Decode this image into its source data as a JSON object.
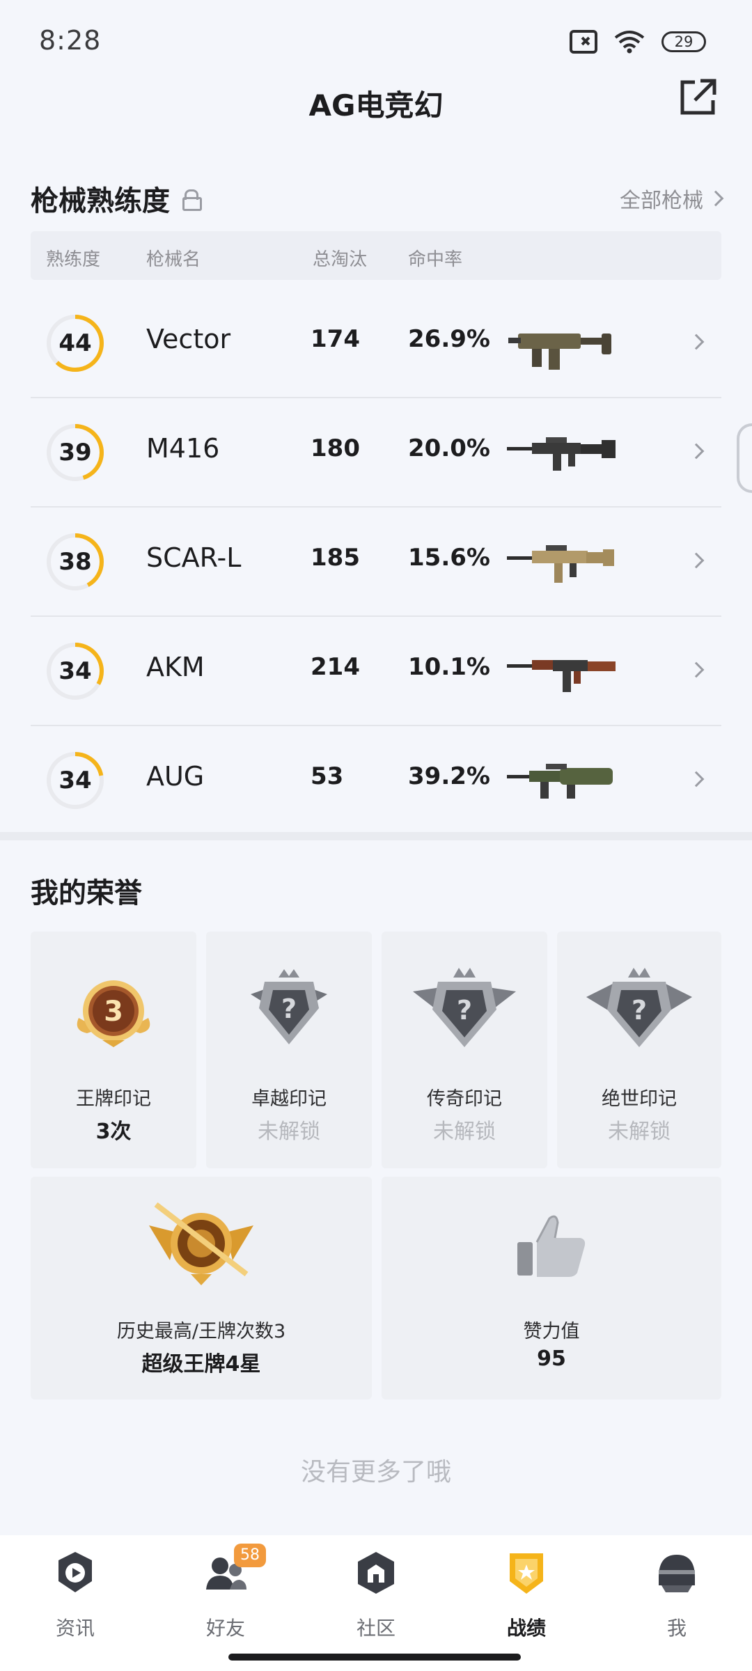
{
  "status": {
    "time": "8:28",
    "battery": "29"
  },
  "header": {
    "title": "AG电竞幻"
  },
  "weapons_section": {
    "title": "枪械熟练度",
    "all_link": "全部枪械",
    "columns": {
      "mastery": "熟练度",
      "name": "枪械名",
      "kills": "总淘汰",
      "accuracy": "命中率"
    },
    "rows": [
      {
        "mastery": "44",
        "name": "Vector",
        "kills": "174",
        "accuracy": "26.9%",
        "progress": 0.62,
        "icon": "smg-vector-icon"
      },
      {
        "mastery": "39",
        "name": "M416",
        "kills": "180",
        "accuracy": "20.0%",
        "progress": 0.45,
        "icon": "rifle-m416-icon"
      },
      {
        "mastery": "38",
        "name": "SCAR-L",
        "kills": "185",
        "accuracy": "15.6%",
        "progress": 0.42,
        "icon": "rifle-scarl-icon"
      },
      {
        "mastery": "34",
        "name": "AKM",
        "kills": "214",
        "accuracy": "10.1%",
        "progress": 0.33,
        "icon": "rifle-akm-icon"
      },
      {
        "mastery": "34",
        "name": "AUG",
        "kills": "53",
        "accuracy": "39.2%",
        "progress": 0.22,
        "icon": "rifle-aug-icon"
      }
    ]
  },
  "honors": {
    "title": "我的荣誉",
    "cards": [
      {
        "label": "王牌印记",
        "value": "3次",
        "locked": false,
        "icon": "ace-mark-badge-icon",
        "badge_number": "3"
      },
      {
        "label": "卓越印记",
        "value": "未解锁",
        "locked": true,
        "icon": "excellence-mark-badge-icon"
      },
      {
        "label": "传奇印记",
        "value": "未解锁",
        "locked": true,
        "icon": "legend-mark-badge-icon"
      },
      {
        "label": "绝世印记",
        "value": "未解锁",
        "locked": true,
        "icon": "peerless-mark-badge-icon"
      }
    ],
    "wide_cards": [
      {
        "label": "历史最高/王牌次数3",
        "value": "超级王牌4星",
        "icon": "rank-ace-emblem-icon"
      },
      {
        "label": "赞力值",
        "value": "95",
        "icon": "thumbs-up-icon"
      }
    ]
  },
  "footer_note": "没有更多了哦",
  "bottom_nav": [
    {
      "label": "资讯",
      "icon": "news-icon",
      "active": false
    },
    {
      "label": "好友",
      "icon": "friends-icon",
      "active": false,
      "badge": "58"
    },
    {
      "label": "社区",
      "icon": "community-icon",
      "active": false
    },
    {
      "label": "战绩",
      "icon": "record-icon",
      "active": true
    },
    {
      "label": "我",
      "icon": "profile-helmet-icon",
      "active": false
    }
  ],
  "colors": {
    "accent": "#f5b41a",
    "ring_track": "#e9eaee",
    "badge": "#f29a3d"
  }
}
